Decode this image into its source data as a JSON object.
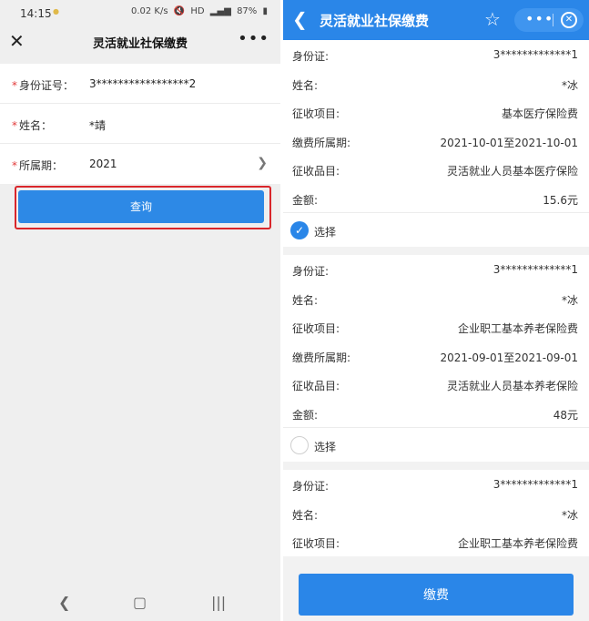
{
  "left": {
    "status": {
      "time": "14:15",
      "battery": "87%",
      "net": "HD",
      "speed": "0.02 K/s"
    },
    "nav": {
      "title": "灵活就业社保缴费"
    },
    "form": [
      {
        "label": "身份证号：",
        "value": "3*****************2"
      },
      {
        "label": "姓名：",
        "value": "*靖"
      },
      {
        "label": "所属期：",
        "value": "2021"
      }
    ],
    "query_label": "查询"
  },
  "right": {
    "header": {
      "title": "灵活就业社保缴费"
    },
    "records": [
      {
        "rows": [
          {
            "label": "身份证:",
            "value": "3*************1"
          },
          {
            "label": "姓名:",
            "value": "*冰"
          },
          {
            "label": "征收项目:",
            "value": "基本医疗保险费"
          },
          {
            "label": "缴费所属期:",
            "value": "2021-10-01至2021-10-01"
          },
          {
            "label": "征收品目:",
            "value": "灵活就业人员基本医疗保险"
          },
          {
            "label": "金额:",
            "value": "15.6元"
          }
        ],
        "select_label": "选择",
        "selected": true
      },
      {
        "rows": [
          {
            "label": "身份证:",
            "value": "3*************1"
          },
          {
            "label": "姓名:",
            "value": "*冰"
          },
          {
            "label": "征收项目:",
            "value": "企业职工基本养老保险费"
          },
          {
            "label": "缴费所属期:",
            "value": "2021-09-01至2021-09-01"
          },
          {
            "label": "征收品目:",
            "value": "灵活就业人员基本养老保险"
          },
          {
            "label": "金额:",
            "value": "48元"
          }
        ],
        "select_label": "选择",
        "selected": false
      },
      {
        "rows": [
          {
            "label": "身份证:",
            "value": "3*************1"
          },
          {
            "label": "姓名:",
            "value": "*冰"
          },
          {
            "label": "征收项目:",
            "value": "企业职工基本养老保险费"
          }
        ]
      }
    ],
    "pay_label": "缴费"
  },
  "colors": {
    "primary": "#2a86e8",
    "highlight": "#d9262b",
    "required": "#e23b3b"
  }
}
